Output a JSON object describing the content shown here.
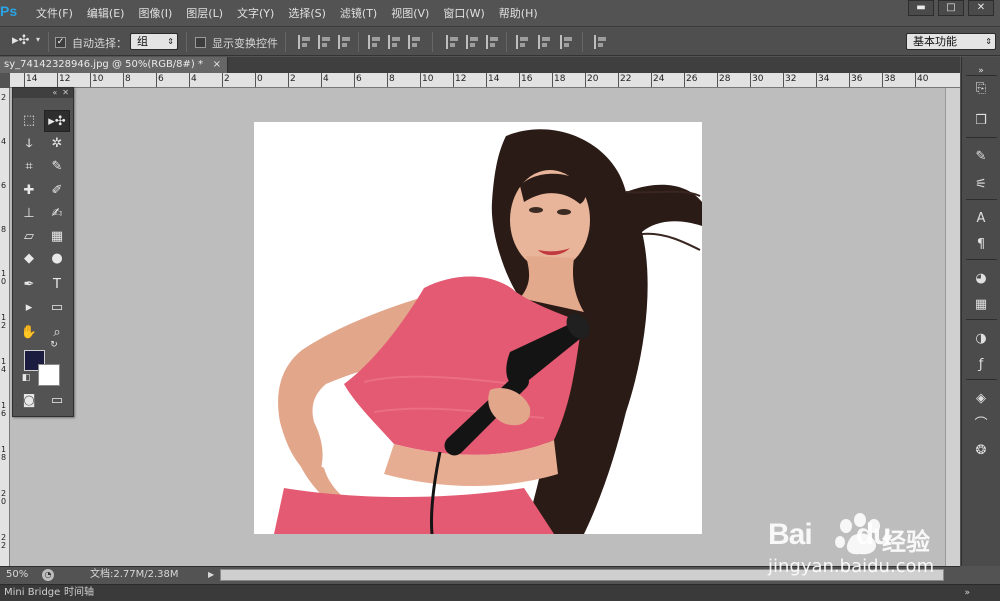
{
  "app": {
    "logo": "Ps"
  },
  "menu": {
    "items": [
      "文件(F)",
      "编辑(E)",
      "图像(I)",
      "图层(L)",
      "文字(Y)",
      "选择(S)",
      "滤镜(T)",
      "视图(V)",
      "窗口(W)",
      "帮助(H)"
    ]
  },
  "window_controls": {
    "minimize": "▬",
    "maximize": "□",
    "close": "✕"
  },
  "options": {
    "auto_select_label": "自动选择：",
    "auto_select_checked": true,
    "auto_select_value": "组",
    "show_transform_label": "显示变换控件",
    "show_transform_checked": false,
    "workspace_value": "基本功能"
  },
  "document": {
    "tab_title": "sy_74142328946.jpg @ 50%(RGB/8#) *",
    "close_glyph": "×"
  },
  "rulers": {
    "top_labels": [
      "14",
      "12",
      "10",
      "8",
      "6",
      "4",
      "2",
      "0",
      "2",
      "4",
      "6",
      "8",
      "10",
      "12",
      "14",
      "16",
      "18",
      "20",
      "22",
      "24",
      "26",
      "28",
      "30",
      "32",
      "34",
      "36",
      "38",
      "40"
    ],
    "left_labels": [
      "2",
      "4",
      "6",
      "8",
      "10",
      "12",
      "14",
      "16",
      "18",
      "20",
      "22"
    ]
  },
  "status": {
    "zoom": "50%",
    "doc_info": "文档:2.77M/2.38M",
    "arrow": "▶"
  },
  "bottom_tabs": [
    "Mini Bridge",
    "时间轴"
  ],
  "colors": {
    "foreground": "#1b1c3f",
    "background": "#ffffff",
    "canvas_bg": "#bdbdbd",
    "ui_bg": "#535353"
  },
  "watermark": {
    "brand": "Bai",
    "brand2": "du",
    "suffix": "经验",
    "url": "jingyan.baidu.com"
  }
}
